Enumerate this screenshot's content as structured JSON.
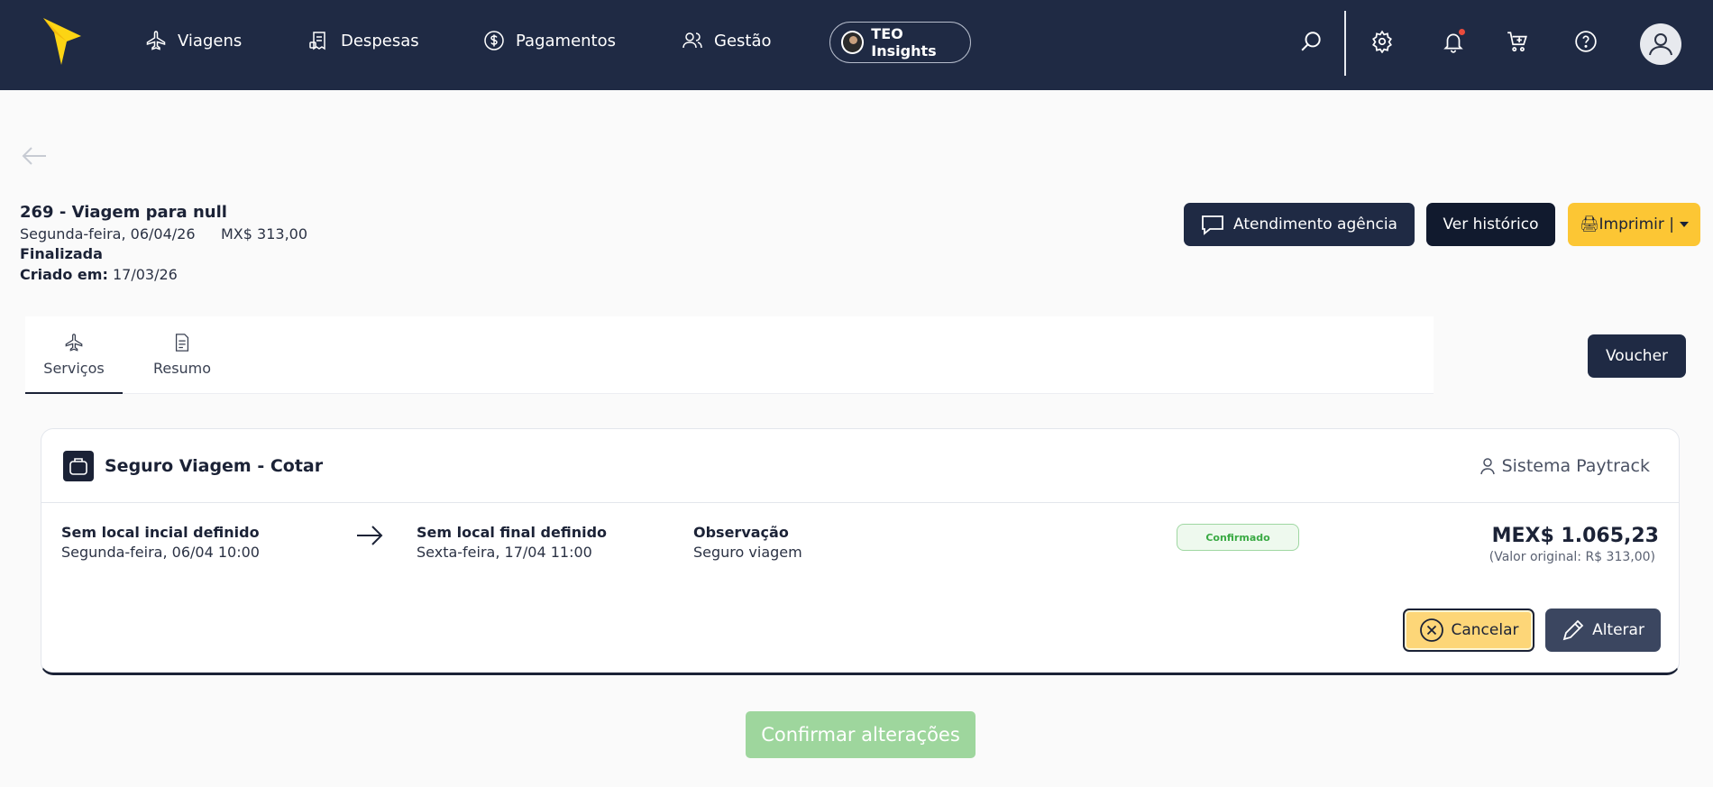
{
  "nav": {
    "items": [
      {
        "label": "Viagens",
        "icon": "plane-icon"
      },
      {
        "label": "Despesas",
        "icon": "receipt-icon"
      },
      {
        "label": "Pagamentos",
        "icon": "dollar-icon"
      },
      {
        "label": "Gestão",
        "icon": "users-icon"
      }
    ],
    "teo_label": "TEO Insights",
    "icons": [
      "search-icon",
      "gear-icon",
      "bell-icon",
      "cart-icon",
      "help-icon",
      "user-avatar"
    ]
  },
  "trip": {
    "title": "269 - Viagem para null",
    "date": "Segunda-feira, 06/04/26",
    "amount": "MX$ 313,00",
    "status": "Finalizada",
    "created_label": "Criado em:",
    "created_value": "17/03/26"
  },
  "actions": {
    "atendimento": "Atendimento agência",
    "historico": "Ver histórico",
    "imprimir": "🖨Imprimir |",
    "voucher": "Voucher"
  },
  "tabs": [
    {
      "label": "Serviços",
      "active": true
    },
    {
      "label": "Resumo",
      "active": false
    }
  ],
  "service": {
    "title": "Seguro Viagem - Cotar",
    "provider": "Sistema Paytrack",
    "origin_label": "Sem local incial definido",
    "origin_date": "Segunda-feira, 06/04 10:00",
    "destination_label": "Sem local final definido",
    "destination_date": "Sexta-feira, 17/04 11:00",
    "obs_label": "Observação",
    "obs_value": "Seguro viagem",
    "status": "Confirmado",
    "price": "MEX$ 1.065,23",
    "price_original": "(Valor original: R$ 313,00)",
    "cancel_label": "Cancelar",
    "alter_label": "Alterar"
  },
  "confirm_label": "Confirmar alterações",
  "colors": {
    "navy": "#1f2a44",
    "yellow": "#fcc634",
    "green_disabled": "#9ed69d",
    "status_green": "#3aaa44"
  }
}
